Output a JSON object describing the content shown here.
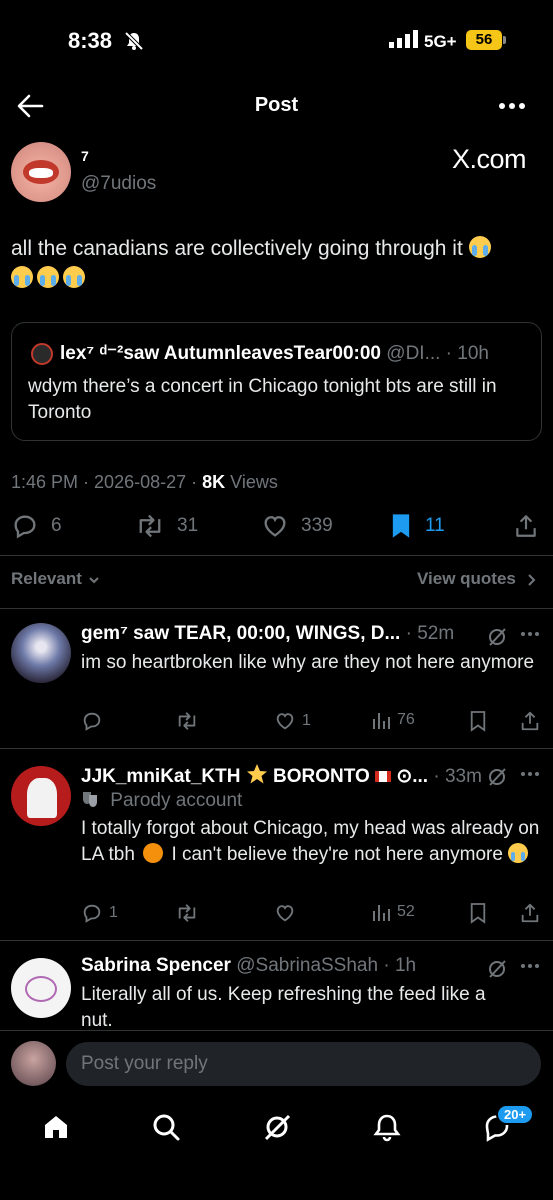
{
  "status_bar": {
    "time": "8:38",
    "network": "5G+",
    "battery": "56"
  },
  "header": {
    "title": "Post"
  },
  "post": {
    "author_name": "7",
    "author_handle": "@7udios",
    "watermark": "X.com",
    "text": "all the canadians are collectively going through it",
    "quote": {
      "author_name": "lex⁷ ᵈ⁻²saw AutumnleavesTear00:00",
      "author_handle": "@DI...",
      "time_sep": " · ",
      "time": "10h",
      "text": "wdym there’s a concert in Chicago tonight bts are still in Toronto"
    },
    "meta": {
      "time": "1:46 PM",
      "sep": " · ",
      "date": "2026-08-27",
      "views_count": "8K",
      "views_label": " Views"
    },
    "stats": {
      "replies": "6",
      "reposts": "31",
      "likes": "339",
      "bookmarks": "11"
    }
  },
  "filters": {
    "sort_label": "Relevant",
    "view_quotes_label": "View quotes"
  },
  "replies": [
    {
      "name": "gem⁷ saw TEAR, 00:00, WINGS, D...",
      "time": " · 52m",
      "text": "im so heartbroken like why are they not here anymore",
      "replies": "",
      "reposts": "",
      "likes": "1",
      "views": "76"
    },
    {
      "name": "JJK_mniKat_KTH",
      "name_suffix": "BORONTO",
      "name_tail": "⊙...",
      "time": " · 33m",
      "parody_label": "Parody account",
      "text_a": "I totally forgot about Chicago, my head was already on LA tbh",
      "text_b": " I can't believe they're not here anymore",
      "replies": "1",
      "reposts": "",
      "likes": "",
      "views": "52"
    },
    {
      "name": "Sabrina Spencer",
      "handle": " @SabrinaSShah",
      "time": " · 1h",
      "text": "Literally all of us. Keep refreshing the feed like a nut."
    }
  ],
  "composer": {
    "placeholder": "Post your reply"
  },
  "bottom_nav": {
    "messages_badge": "20+"
  },
  "colors": {
    "accent": "#1d9bf0",
    "background": "#000000",
    "muted": "#71767b",
    "text": "#e7e9ea"
  },
  "icons": [
    "back-arrow-icon",
    "more-icon",
    "reply-icon",
    "repost-icon",
    "like-icon",
    "bookmark-icon",
    "share-icon",
    "views-icon",
    "grok-icon",
    "home-icon",
    "search-icon",
    "notifications-icon",
    "messages-icon"
  ]
}
